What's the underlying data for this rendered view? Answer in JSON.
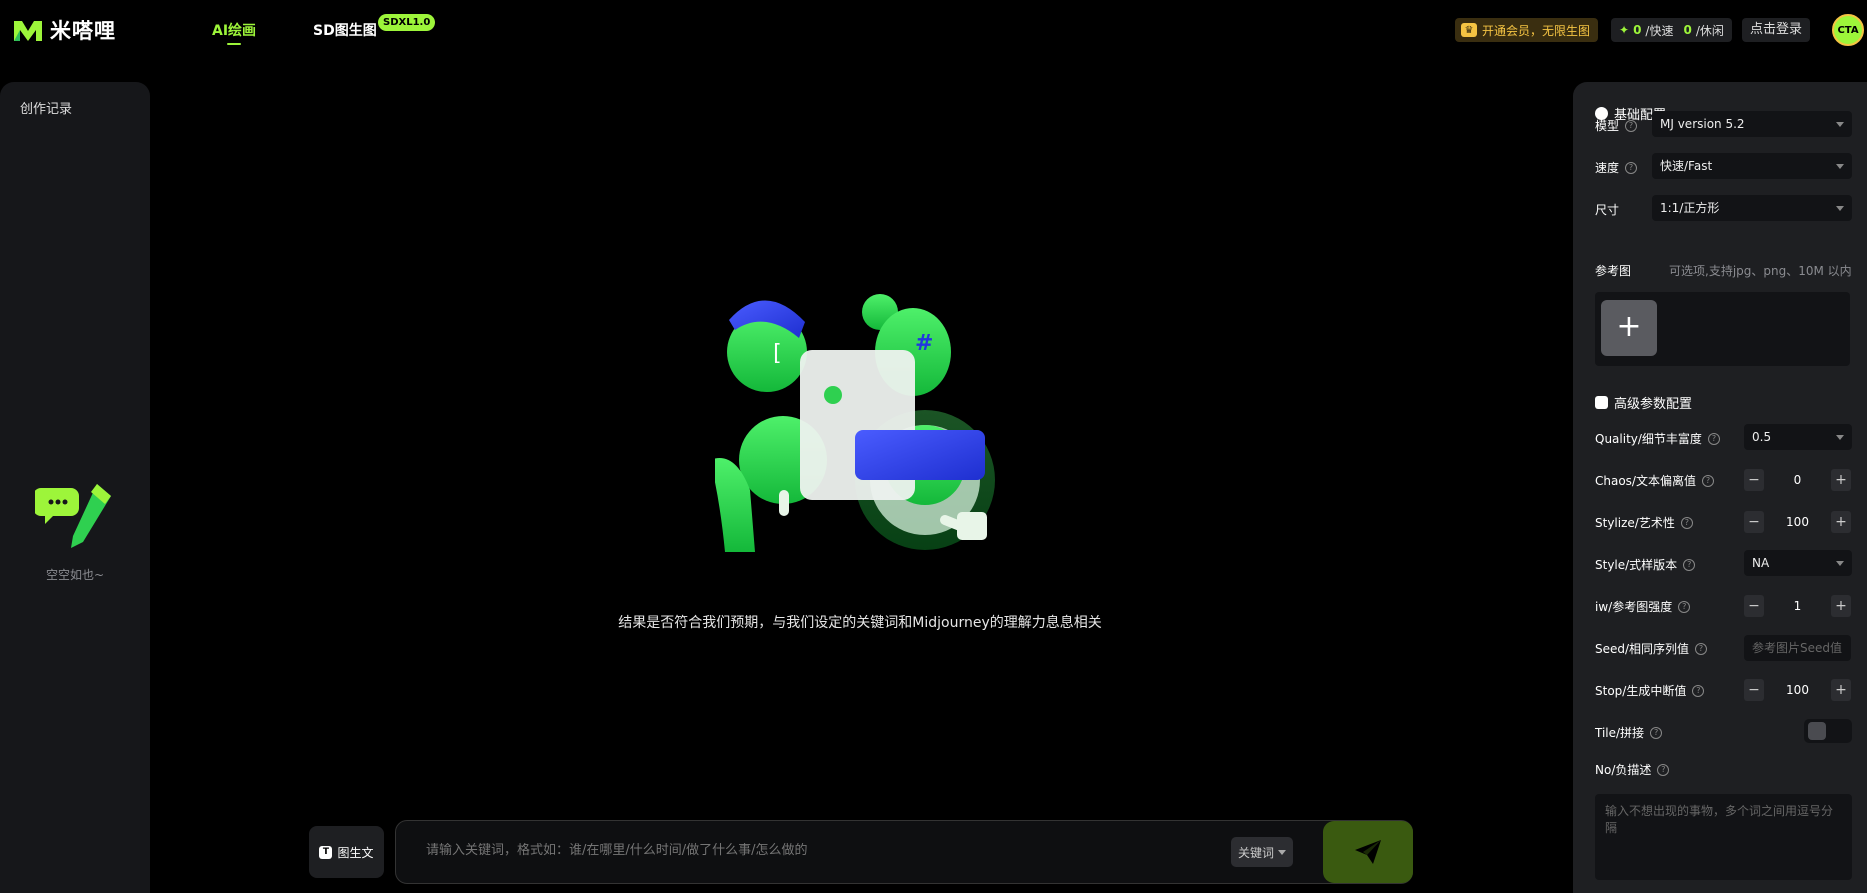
{
  "header": {
    "logo_text": "米嗒哩",
    "tabs": [
      {
        "label": "AI绘画",
        "active": true
      },
      {
        "label": "SD图生图",
        "active": false
      }
    ],
    "sd_badge": "SDXL1.0",
    "vip_label": "开通会员，无限生图",
    "speed": {
      "fast_count": "0",
      "fast_label": "/快速",
      "idle_count": "0",
      "idle_label": "/休闲"
    },
    "login_label": "点击登录",
    "avatar_text": "CTA"
  },
  "left_panel": {
    "title": "创作记录",
    "empty_text": "空空如也~"
  },
  "main": {
    "hint": "结果是否符合我们预期，与我们设定的关键词和Midjourney的理解力息息相关"
  },
  "prompt_bar": {
    "img2txt_label": "图生文",
    "img2txt_icon": "T",
    "placeholder": "请输入关键词，格式如：谁/在哪里/什么时间/做了什么事/怎么做的",
    "keyword_label": "关键词"
  },
  "right_panel": {
    "basic_title": "基础配置",
    "model": {
      "label": "模型",
      "value": "MJ version 5.2"
    },
    "speed": {
      "label": "速度",
      "value": "快速/Fast"
    },
    "size": {
      "label": "尺寸",
      "value": "1:1/正方形"
    },
    "reference": {
      "label": "参考图",
      "hint": "可选项,支持jpg、png、10M 以内",
      "add_symbol": "+"
    },
    "advanced_title": "高级参数配置",
    "quality": {
      "label": "Quality/细节丰富度",
      "value": "0.5"
    },
    "chaos": {
      "label": "Chaos/文本偏离值",
      "value": "0"
    },
    "stylize": {
      "label": "Stylize/艺术性",
      "value": "100"
    },
    "style": {
      "label": "Style/式样版本",
      "value": "NA"
    },
    "iw": {
      "label": "iw/参考图强度",
      "value": "1"
    },
    "seed": {
      "label": "Seed/相同序列值",
      "placeholder": "参考图片Seed值"
    },
    "stop": {
      "label": "Stop/生成中断值",
      "value": "100"
    },
    "tile": {
      "label": "Tile/拼接",
      "enabled": false
    },
    "no": {
      "label": "No/负描述",
      "placeholder": "输入不想出现的事物，多个词之间用逗号分隔"
    },
    "help_symbol": "?",
    "minus_symbol": "−",
    "plus_symbol": "+"
  },
  "colors": {
    "accent": "#9df53a",
    "vip": "#f5c443",
    "panel": "#1e1f22"
  }
}
